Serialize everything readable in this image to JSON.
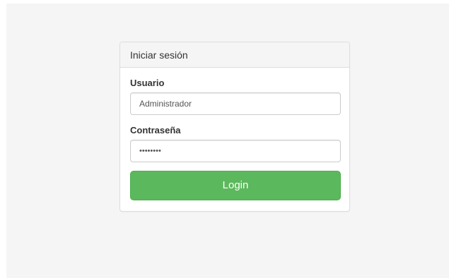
{
  "login_panel": {
    "title": "Iniciar sesión",
    "username": {
      "label": "Usuario",
      "value": "Administrador"
    },
    "password": {
      "label": "Contraseña",
      "value": "••••••••"
    },
    "submit_label": "Login"
  },
  "colors": {
    "page_background": "#f5f5f5",
    "panel_heading_background": "#f5f5f5",
    "panel_border": "#dddddd",
    "button_background": "#5cb85c",
    "button_text": "#ffffff"
  }
}
